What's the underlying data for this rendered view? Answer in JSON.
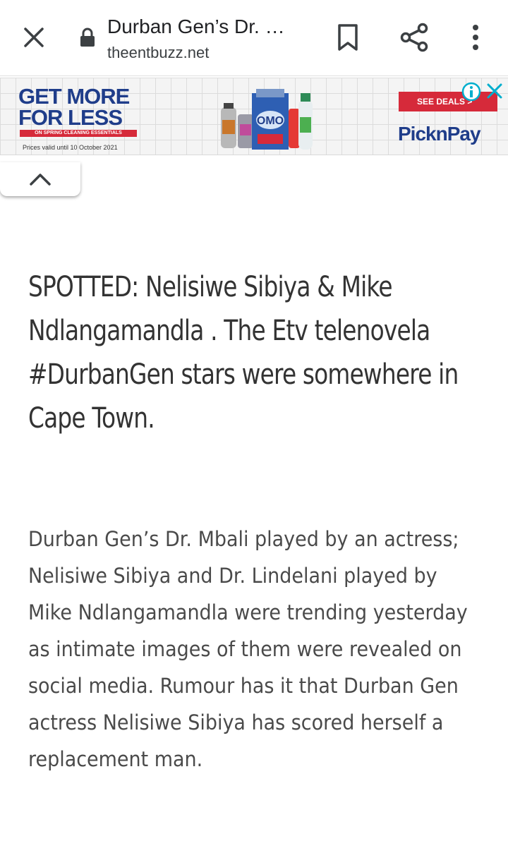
{
  "browser": {
    "title": "Durban Gen’s Dr. …",
    "url": "theentbuzz.net",
    "icons": {
      "close": "close-icon",
      "lock": "lock-icon",
      "bookmark": "bookmark-icon",
      "share": "share-icon",
      "menu": "more-vert-icon"
    }
  },
  "ad": {
    "headline_line1": "GET MORE",
    "headline_line2": "FOR LESS",
    "strip_text": "ON SPRING CLEANING ESSENTIALS",
    "validity": "Prices valid until 10 October 2021",
    "cta": "SEE DEALS >",
    "brand": "PicknPay",
    "colors": {
      "brand_blue": "#1f3d8a",
      "brand_red": "#d62a3a",
      "adchoices_blue": "#00aecd"
    }
  },
  "article": {
    "headline": "SPOTTED: Nelisiwe Sibiya & Mike Ndlangamandla . The Etv telenovela #DurbanGen stars were somewhere in Cape Town.",
    "body": "Durban Gen’s Dr. Mbali played by an actress; Nelisiwe Sibiya and Dr. Lindelani played by Mike Ndlangamandla were trending yesterday as intimate images of them were revealed on social media. Rumour has it that Durban Gen actress Nelisiwe Sibiya has scored herself a replacement man."
  }
}
